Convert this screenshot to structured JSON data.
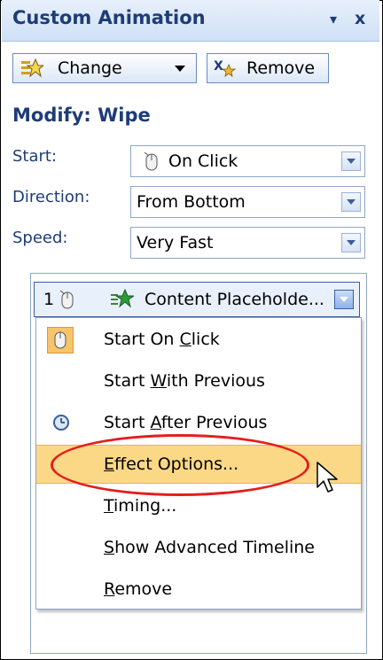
{
  "panel": {
    "title": "Custom Animation",
    "chevron": "▾",
    "close": "x"
  },
  "toolbar": {
    "change_label": "Change",
    "remove_label": "Remove"
  },
  "modify": {
    "heading": "Modify: Wipe",
    "start_label": "Start:",
    "start_value": "On Click",
    "direction_label": "Direction:",
    "direction_value": "From Bottom",
    "speed_label": "Speed:",
    "speed_value": "Very Fast"
  },
  "animation_list": {
    "item_number": "1",
    "item_label": "Content Placeholde..."
  },
  "context_menu": {
    "items": [
      {
        "pre": "Start On ",
        "u": "C",
        "post": "lick"
      },
      {
        "pre": "Start ",
        "u": "W",
        "post": "ith Previous"
      },
      {
        "pre": "Start ",
        "u": "A",
        "post": "fter Previous"
      },
      {
        "pre": "",
        "u": "E",
        "post": "ffect Options..."
      },
      {
        "pre": "",
        "u": "T",
        "post": "iming..."
      },
      {
        "pre": "",
        "u": "S",
        "post": "how Advanced Timeline"
      },
      {
        "pre": "",
        "u": "R",
        "post": "emove"
      }
    ]
  },
  "colors": {
    "title_blue": "#1e3c78",
    "highlight": "#fbd886",
    "annotation_red": "#e41e1e"
  }
}
